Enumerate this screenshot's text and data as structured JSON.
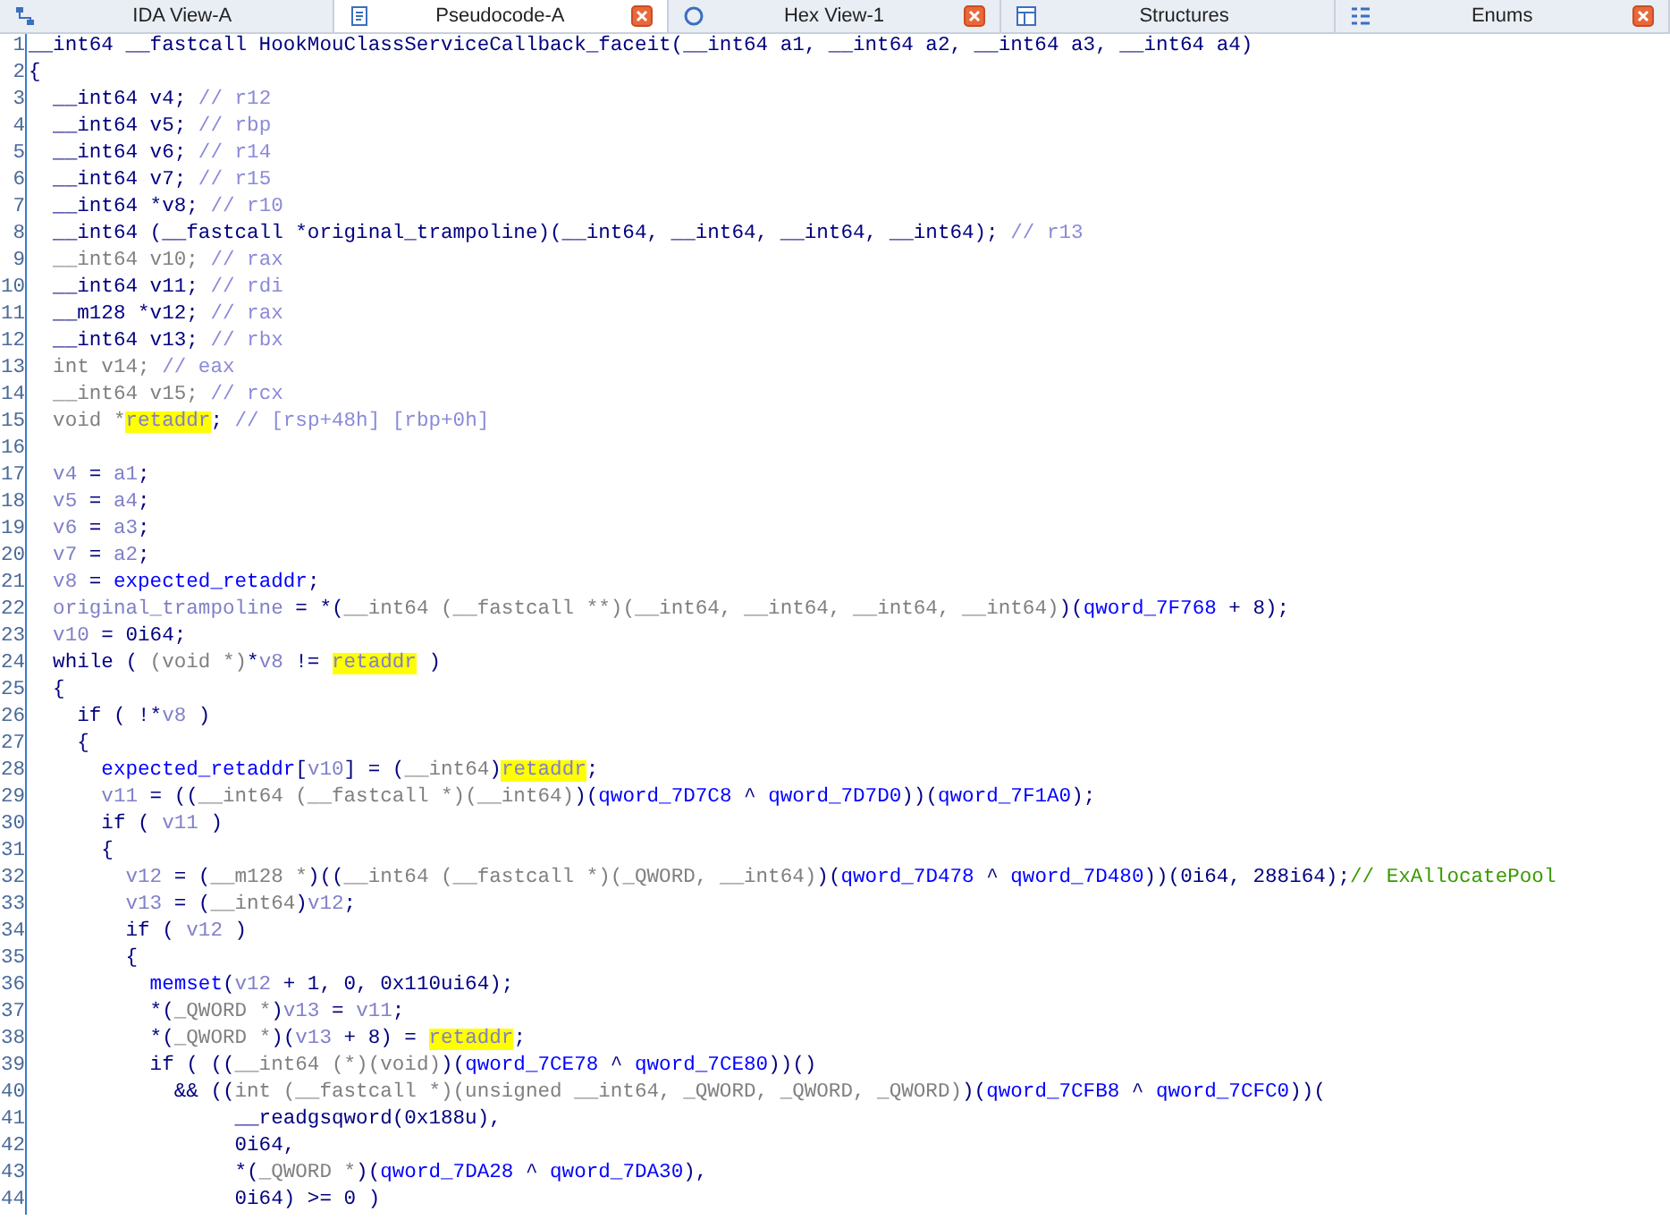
{
  "tabs": [
    {
      "label": "IDA View-A",
      "kind": "graph",
      "selected": false,
      "closable": false
    },
    {
      "label": "Pseudocode-A",
      "kind": "code",
      "selected": true,
      "closable": true
    },
    {
      "label": "Hex View-1",
      "kind": "hex",
      "selected": false,
      "closable": true
    },
    {
      "label": "Structures",
      "kind": "table",
      "selected": false,
      "closable": false
    },
    {
      "label": "Enums",
      "kind": "list",
      "selected": false,
      "closable": true
    }
  ],
  "code_lines": [
    {
      "number": "1",
      "tokens": [
        {
          "text": "__int64 __fastcall HookMouClassServiceCallback_faceit(__int64 a1, __int64 a2, __int64 a3, __int64 a4)",
          "kind": "plain"
        }
      ]
    },
    {
      "number": "2",
      "tokens": [
        {
          "text": "{",
          "kind": "plain"
        }
      ]
    },
    {
      "number": "3",
      "tokens": [
        {
          "text": "  __int64 v4; ",
          "kind": "plain"
        },
        {
          "text": "// r12",
          "kind": "note"
        }
      ]
    },
    {
      "number": "4",
      "tokens": [
        {
          "text": "  __int64 v5; ",
          "kind": "plain"
        },
        {
          "text": "// rbp",
          "kind": "note"
        }
      ]
    },
    {
      "number": "5",
      "tokens": [
        {
          "text": "  __int64 v6; ",
          "kind": "plain"
        },
        {
          "text": "// r14",
          "kind": "note"
        }
      ]
    },
    {
      "number": "6",
      "tokens": [
        {
          "text": "  __int64 v7; ",
          "kind": "plain"
        },
        {
          "text": "// r15",
          "kind": "note"
        }
      ]
    },
    {
      "number": "7",
      "tokens": [
        {
          "text": "  __int64 *v8; ",
          "kind": "plain"
        },
        {
          "text": "// r10",
          "kind": "note"
        }
      ]
    },
    {
      "number": "8",
      "tokens": [
        {
          "text": "  __int64 (__fastcall *original_trampoline)(__int64, __int64, __int64, __int64); ",
          "kind": "plain"
        },
        {
          "text": "// r13",
          "kind": "note"
        }
      ]
    },
    {
      "number": "9",
      "tokens": [
        {
          "text": "  __int64 v10; ",
          "kind": "cast"
        },
        {
          "text": "// rax",
          "kind": "note"
        }
      ]
    },
    {
      "number": "10",
      "tokens": [
        {
          "text": "  __int64 v11; ",
          "kind": "plain"
        },
        {
          "text": "// rdi",
          "kind": "note"
        }
      ]
    },
    {
      "number": "11",
      "tokens": [
        {
          "text": "  __m128 *v12; ",
          "kind": "plain"
        },
        {
          "text": "// rax",
          "kind": "note"
        }
      ]
    },
    {
      "number": "12",
      "tokens": [
        {
          "text": "  __int64 v13; ",
          "kind": "plain"
        },
        {
          "text": "// rbx",
          "kind": "note"
        }
      ]
    },
    {
      "number": "13",
      "tokens": [
        {
          "text": "  int v14; ",
          "kind": "cast"
        },
        {
          "text": "// eax",
          "kind": "note"
        }
      ]
    },
    {
      "number": "14",
      "tokens": [
        {
          "text": "  __int64 v15; ",
          "kind": "cast"
        },
        {
          "text": "// rcx",
          "kind": "note"
        }
      ]
    },
    {
      "number": "15",
      "tokens": [
        {
          "text": "  void *",
          "kind": "cast"
        },
        {
          "text": "retaddr",
          "kind": "mark"
        },
        {
          "text": "; ",
          "kind": "plain"
        },
        {
          "text": "// [rsp+48h] [rbp+0h]",
          "kind": "note"
        }
      ]
    },
    {
      "number": "16"
    },
    {
      "number": "17",
      "tokens": [
        {
          "text": "  v4",
          "kind": "local"
        },
        {
          "text": " = ",
          "kind": "plain"
        },
        {
          "text": "a1",
          "kind": "local"
        },
        {
          "text": ";",
          "kind": "plain"
        }
      ]
    },
    {
      "number": "18",
      "tokens": [
        {
          "text": "  v5",
          "kind": "local"
        },
        {
          "text": " = ",
          "kind": "plain"
        },
        {
          "text": "a4",
          "kind": "local"
        },
        {
          "text": ";",
          "kind": "plain"
        }
      ]
    },
    {
      "number": "19",
      "tokens": [
        {
          "text": "  v6",
          "kind": "local"
        },
        {
          "text": " = ",
          "kind": "plain"
        },
        {
          "text": "a3",
          "kind": "local"
        },
        {
          "text": ";",
          "kind": "plain"
        }
      ]
    },
    {
      "number": "20",
      "tokens": [
        {
          "text": "  v7",
          "kind": "local"
        },
        {
          "text": " = ",
          "kind": "plain"
        },
        {
          "text": "a2",
          "kind": "local"
        },
        {
          "text": ";",
          "kind": "plain"
        }
      ]
    },
    {
      "number": "21",
      "tokens": [
        {
          "text": "  v8",
          "kind": "local"
        },
        {
          "text": " = ",
          "kind": "plain"
        },
        {
          "text": "expected_retaddr",
          "kind": "global"
        },
        {
          "text": ";",
          "kind": "plain"
        }
      ]
    },
    {
      "number": "22",
      "tokens": [
        {
          "text": "  original_trampoline",
          "kind": "local"
        },
        {
          "text": " = *(",
          "kind": "plain"
        },
        {
          "text": "__int64 (__fastcall **)(__int64, __int64, __int64, __int64)",
          "kind": "cast"
        },
        {
          "text": ")(",
          "kind": "plain"
        },
        {
          "text": "qword_7F768",
          "kind": "global"
        },
        {
          "text": " + 8);",
          "kind": "plain"
        }
      ]
    },
    {
      "number": "23",
      "tokens": [
        {
          "text": "  v10",
          "kind": "local"
        },
        {
          "text": " = 0i64;",
          "kind": "plain"
        }
      ]
    },
    {
      "number": "24",
      "tokens": [
        {
          "text": "  while ( ",
          "kind": "plain"
        },
        {
          "text": "(void *)",
          "kind": "cast"
        },
        {
          "text": "*",
          "kind": "plain"
        },
        {
          "text": "v8",
          "kind": "local"
        },
        {
          "text": " != ",
          "kind": "plain"
        },
        {
          "text": "retaddr",
          "kind": "mark"
        },
        {
          "text": " )",
          "kind": "plain"
        }
      ]
    },
    {
      "number": "25",
      "tokens": [
        {
          "text": "  {",
          "kind": "plain"
        }
      ]
    },
    {
      "number": "26",
      "tokens": [
        {
          "text": "    if ( !*",
          "kind": "plain"
        },
        {
          "text": "v8",
          "kind": "local"
        },
        {
          "text": " )",
          "kind": "plain"
        }
      ]
    },
    {
      "number": "27",
      "tokens": [
        {
          "text": "    {",
          "kind": "plain"
        }
      ]
    },
    {
      "number": "28",
      "tokens": [
        {
          "text": "      expected_retaddr",
          "kind": "global"
        },
        {
          "text": "[",
          "kind": "plain"
        },
        {
          "text": "v10",
          "kind": "local"
        },
        {
          "text": "] = (",
          "kind": "plain"
        },
        {
          "text": "__int64",
          "kind": "cast"
        },
        {
          "text": ")",
          "kind": "plain"
        },
        {
          "text": "retaddr",
          "kind": "mark"
        },
        {
          "text": ";",
          "kind": "plain"
        }
      ]
    },
    {
      "number": "29",
      "tokens": [
        {
          "text": "      v11",
          "kind": "local"
        },
        {
          "text": " = ((",
          "kind": "plain"
        },
        {
          "text": "__int64 (__fastcall *)(__int64)",
          "kind": "cast"
        },
        {
          "text": ")(",
          "kind": "plain"
        },
        {
          "text": "qword_7D7C8",
          "kind": "global"
        },
        {
          "text": " ^ ",
          "kind": "plain"
        },
        {
          "text": "qword_7D7D0",
          "kind": "global"
        },
        {
          "text": "))(",
          "kind": "plain"
        },
        {
          "text": "qword_7F1A0",
          "kind": "global"
        },
        {
          "text": ");",
          "kind": "plain"
        }
      ]
    },
    {
      "number": "30",
      "tokens": [
        {
          "text": "      if ( ",
          "kind": "plain"
        },
        {
          "text": "v11",
          "kind": "local"
        },
        {
          "text": " )",
          "kind": "plain"
        }
      ]
    },
    {
      "number": "31",
      "tokens": [
        {
          "text": "      {",
          "kind": "plain"
        }
      ]
    },
    {
      "number": "32",
      "tokens": [
        {
          "text": "        v12",
          "kind": "local"
        },
        {
          "text": " = (",
          "kind": "plain"
        },
        {
          "text": "__m128 *",
          "kind": "cast"
        },
        {
          "text": ")((",
          "kind": "plain"
        },
        {
          "text": "__int64 (__fastcall *)(_QWORD, __int64)",
          "kind": "cast"
        },
        {
          "text": ")(",
          "kind": "plain"
        },
        {
          "text": "qword_7D478",
          "kind": "global"
        },
        {
          "text": " ^ ",
          "kind": "plain"
        },
        {
          "text": "qword_7D480",
          "kind": "global"
        },
        {
          "text": "))(0i64, 288i64);",
          "kind": "plain"
        },
        {
          "text": "// ExAllocatePool",
          "kind": "comment"
        }
      ]
    },
    {
      "number": "33",
      "tokens": [
        {
          "text": "        v13",
          "kind": "local"
        },
        {
          "text": " = (",
          "kind": "plain"
        },
        {
          "text": "__int64",
          "kind": "cast"
        },
        {
          "text": ")",
          "kind": "plain"
        },
        {
          "text": "v12",
          "kind": "local"
        },
        {
          "text": ";",
          "kind": "plain"
        }
      ]
    },
    {
      "number": "34",
      "tokens": [
        {
          "text": "        if ( ",
          "kind": "plain"
        },
        {
          "text": "v12",
          "kind": "local"
        },
        {
          "text": " )",
          "kind": "plain"
        }
      ]
    },
    {
      "number": "35",
      "tokens": [
        {
          "text": "        {",
          "kind": "plain"
        }
      ]
    },
    {
      "number": "36",
      "tokens": [
        {
          "text": "          memset",
          "kind": "global"
        },
        {
          "text": "(",
          "kind": "plain"
        },
        {
          "text": "v12",
          "kind": "local"
        },
        {
          "text": " + 1, 0, 0x110ui64);",
          "kind": "plain"
        }
      ]
    },
    {
      "number": "37",
      "tokens": [
        {
          "text": "          *(",
          "kind": "plain"
        },
        {
          "text": "_QWORD *",
          "kind": "cast"
        },
        {
          "text": ")",
          "kind": "plain"
        },
        {
          "text": "v13",
          "kind": "local"
        },
        {
          "text": " = ",
          "kind": "plain"
        },
        {
          "text": "v11",
          "kind": "local"
        },
        {
          "text": ";",
          "kind": "plain"
        }
      ]
    },
    {
      "number": "38",
      "tokens": [
        {
          "text": "          *(",
          "kind": "plain"
        },
        {
          "text": "_QWORD *",
          "kind": "cast"
        },
        {
          "text": ")(",
          "kind": "plain"
        },
        {
          "text": "v13",
          "kind": "local"
        },
        {
          "text": " + 8) = ",
          "kind": "plain"
        },
        {
          "text": "retaddr",
          "kind": "mark"
        },
        {
          "text": ";",
          "kind": "plain"
        }
      ]
    },
    {
      "number": "39",
      "tokens": [
        {
          "text": "          if ( ((",
          "kind": "plain"
        },
        {
          "text": "__int64 (*)(void)",
          "kind": "cast"
        },
        {
          "text": ")(",
          "kind": "plain"
        },
        {
          "text": "qword_7CE78",
          "kind": "global"
        },
        {
          "text": " ^ ",
          "kind": "plain"
        },
        {
          "text": "qword_7CE80",
          "kind": "global"
        },
        {
          "text": "))()",
          "kind": "plain"
        }
      ]
    },
    {
      "number": "40",
      "tokens": [
        {
          "text": "            && ((",
          "kind": "plain"
        },
        {
          "text": "int (__fastcall *)(unsigned __int64, _QWORD, _QWORD, _QWORD)",
          "kind": "cast"
        },
        {
          "text": ")(",
          "kind": "plain"
        },
        {
          "text": "qword_7CFB8",
          "kind": "global"
        },
        {
          "text": " ^ ",
          "kind": "plain"
        },
        {
          "text": "qword_7CFC0",
          "kind": "global"
        },
        {
          "text": "))(",
          "kind": "plain"
        }
      ]
    },
    {
      "number": "41",
      "tokens": [
        {
          "text": "                 __readgsqword(0x188u),",
          "kind": "plain"
        }
      ]
    },
    {
      "number": "42",
      "tokens": [
        {
          "text": "                 0i64,",
          "kind": "plain"
        }
      ]
    },
    {
      "number": "43",
      "tokens": [
        {
          "text": "                 *(",
          "kind": "plain"
        },
        {
          "text": "_QWORD *",
          "kind": "cast"
        },
        {
          "text": ")(",
          "kind": "plain"
        },
        {
          "text": "qword_7DA28",
          "kind": "global"
        },
        {
          "text": " ^ ",
          "kind": "plain"
        },
        {
          "text": "qword_7DA30",
          "kind": "global"
        },
        {
          "text": "),",
          "kind": "plain"
        }
      ]
    },
    {
      "number": "44",
      "tokens": [
        {
          "text": "                 0i64) >= 0 )",
          "kind": "plain"
        }
      ]
    }
  ]
}
